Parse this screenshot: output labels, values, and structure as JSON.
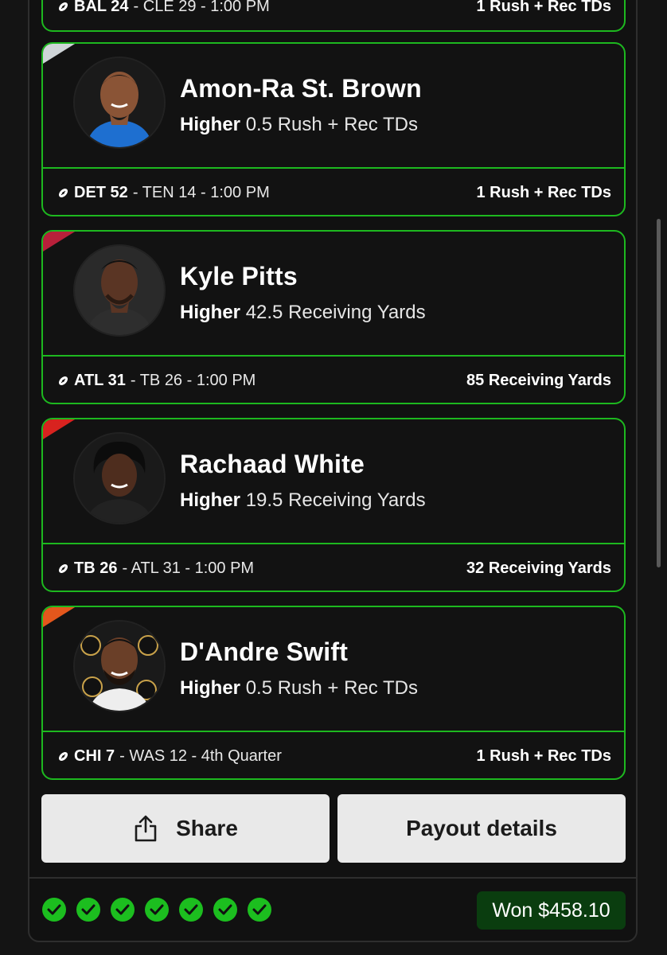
{
  "prev_card": {
    "game_team": "BAL 24",
    "game_rest": " - CLE 29 - 1:00 PM",
    "result": "1 Rush + Rec TDs"
  },
  "picks": [
    {
      "player": "Amon-Ra St. Brown",
      "direction": "Higher",
      "line": "0.5 Rush + Rec TDs",
      "game_team": "DET 52",
      "game_rest": " - TEN 14 - 1:00 PM",
      "result": "1 Rush + Rec TDs",
      "stripe_color": "#4aa3df",
      "stripe_color2": "#cfd5d8"
    },
    {
      "player": "Kyle Pitts",
      "direction": "Higher",
      "line": "42.5 Receiving Yards",
      "game_team": "ATL 31",
      "game_rest": " - TB 26 - 1:00 PM",
      "result": "85 Receiving Yards",
      "stripe_color": "#b8203a",
      "stripe_color2": "#2a2a2a"
    },
    {
      "player": "Rachaad White",
      "direction": "Higher",
      "line": "19.5 Receiving Yards",
      "game_team": "TB 26",
      "game_rest": " - ATL 31 - 1:00 PM",
      "result": "32 Receiving Yards",
      "stripe_color": "#d8231f",
      "stripe_color2": "#3a3a3a"
    },
    {
      "player": "D'Andre Swift",
      "direction": "Higher",
      "line": "0.5 Rush + Rec TDs",
      "game_team": "CHI 7",
      "game_rest": " - WAS 12 - 4th Quarter",
      "result": "1 Rush + Rec TDs",
      "stripe_color": "#e4571c",
      "stripe_color2": "#1c2a4a"
    }
  ],
  "buttons": {
    "share": "Share",
    "payout": "Payout details"
  },
  "footer": {
    "won": "Won $458.10",
    "check_count": 7
  },
  "colors": {
    "accent": "#1db81f",
    "won_bg": "#0a3d0f"
  }
}
